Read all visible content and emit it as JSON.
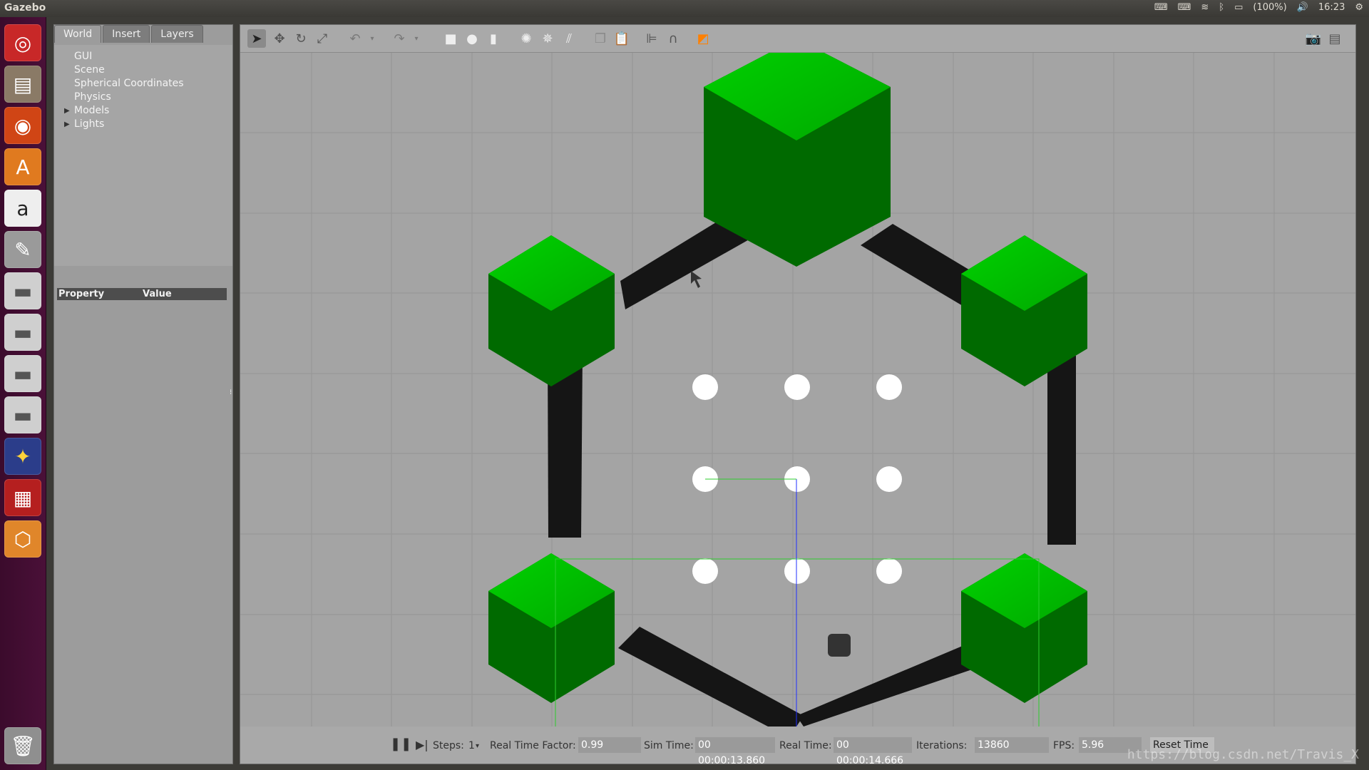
{
  "app": {
    "title": "Gazebo"
  },
  "topbar": {
    "battery": "(100%)",
    "clock": "16:23",
    "icons": [
      "keyboard-icon",
      "keyboard-icon",
      "wifi-icon",
      "bluetooth-icon",
      "battery-icon",
      "volume-icon",
      "gear-icon"
    ]
  },
  "launcher": {
    "items": [
      "ubuntu-logo-icon",
      "files-icon",
      "firefox-icon",
      "software-center-icon",
      "amazon-icon",
      "system-settings-icon",
      "drive-icon",
      "drive-icon",
      "drive-icon",
      "drive-icon",
      "rviz-icon",
      "terminal-app-icon",
      "gazebo-icon",
      "trash-icon"
    ]
  },
  "left_panel": {
    "tabs": [
      "World",
      "Insert",
      "Layers"
    ],
    "tree": [
      "GUI",
      "Scene",
      "Spherical Coordinates",
      "Physics",
      "Models",
      "Lights"
    ],
    "property_header": "Property",
    "value_header": "Value"
  },
  "toolbar": {
    "tools": [
      "select-arrow-icon",
      "translate-icon",
      "rotate-icon",
      "scale-icon",
      "undo-icon",
      "redo-icon",
      "box-shape-icon",
      "sphere-shape-icon",
      "cylinder-shape-icon",
      "point-light-icon",
      "spot-light-icon",
      "directional-light-icon",
      "copy-icon",
      "paste-icon",
      "align-icon",
      "snap-magnet-icon",
      "view-angle-icon"
    ],
    "right_tools": [
      "screenshot-camera-icon",
      "log-icon"
    ]
  },
  "status": {
    "steps_label": "Steps:",
    "steps_value": "1",
    "rtf_label": "Real Time Factor:",
    "rtf_value": "0.99",
    "sim_time_label": "Sim Time:",
    "sim_time_value": "00 00:00:13.860",
    "real_time_label": "Real Time:",
    "real_time_value": "00 00:00:14.666",
    "iterations_label": "Iterations:",
    "iterations_value": "13860",
    "fps_label": "FPS:",
    "fps_value": "5.96",
    "reset_label": "Reset Time"
  },
  "watermark": "https://blog.csdn.net/Travis_X",
  "colors": {
    "launcher_bg": "#3b0b2c",
    "green": "#00c400",
    "dark_green": "#006400",
    "wall": "#151515",
    "ground": "#a4a4a4"
  }
}
